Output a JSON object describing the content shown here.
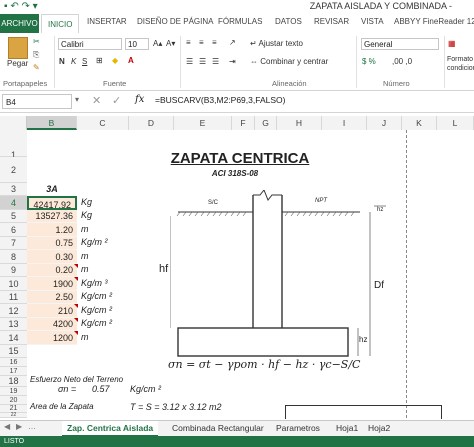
{
  "window": {
    "title": "ZAPATA AISLADA Y COMBINADA -"
  },
  "ribbon_tabs": [
    "ARCHIVO",
    "INICIO",
    "INSERTAR",
    "DISEÑO DE PÁGINA",
    "FÓRMULAS",
    "DATOS",
    "REVISAR",
    "VISTA",
    "ABBYY FineReader 12"
  ],
  "ribbon": {
    "paste_label": "Pegar",
    "font_name": "Calibri",
    "font_size": "10",
    "wrap_text": "Ajustar texto",
    "merge_center": "Combinar y centrar",
    "number_format": "General",
    "conditional_format": "Formato condicional",
    "groups": {
      "clipboard": "Portapapeles",
      "font": "Fuente",
      "alignment": "Alineación",
      "number": "Número"
    },
    "bold": "N",
    "italic": "K",
    "underline": "S"
  },
  "formula_bar": {
    "name_box": "B4",
    "formula": "=BUSCARV(B3,M2:P69,3,FALSO)",
    "fx": "fx"
  },
  "columns": [
    "B",
    "C",
    "D",
    "E",
    "F",
    "G",
    "H",
    "I",
    "J",
    "K",
    "L"
  ],
  "rows": [
    "1",
    "2",
    "3",
    "4",
    "5",
    "6",
    "7",
    "8",
    "9",
    "10",
    "11",
    "12",
    "13",
    "14",
    "15",
    "16",
    "17",
    "18",
    "19",
    "20",
    "21",
    "22"
  ],
  "sheet": {
    "title": "ZAPATA CENTRICA",
    "subtitle": "ACI 318S-08",
    "b3": "3A",
    "values": [
      "42417.92",
      "13527.36",
      "1.20",
      "0.75",
      "0.30",
      "0.20",
      "1900",
      "2.50",
      "210",
      "4200",
      "1200"
    ],
    "units": [
      "Kg",
      "Kg",
      "m",
      "Kg/m ²",
      "m",
      "m",
      "Kg/m ³",
      "Kg/cm ²",
      "Kg/cm ²",
      "Kg/cm ²",
      "m"
    ],
    "row18_label": "Esfuerzo Neto del Terreno",
    "row19_sym": "σn  =",
    "row19_val": "0.57",
    "row19_unit": "Kg/cm ²",
    "formula_text": "σn = σt − γpom · hf − hz · γc−S/C",
    "row21_label": "Area de la Zapata",
    "row21_eq": "T = S = 3.12 x 3.12 m2",
    "diagram": {
      "sc": "S/C",
      "npt": "NPT",
      "hz_top": "hz",
      "hf": "hf",
      "df": "Df",
      "hz": "hz"
    }
  },
  "sheet_tabs": [
    "Zap. Centrica Aislada",
    "Combinada Rectangular",
    "Parametros",
    "Hoja1",
    "Hoja2"
  ],
  "status": "LISTO"
}
